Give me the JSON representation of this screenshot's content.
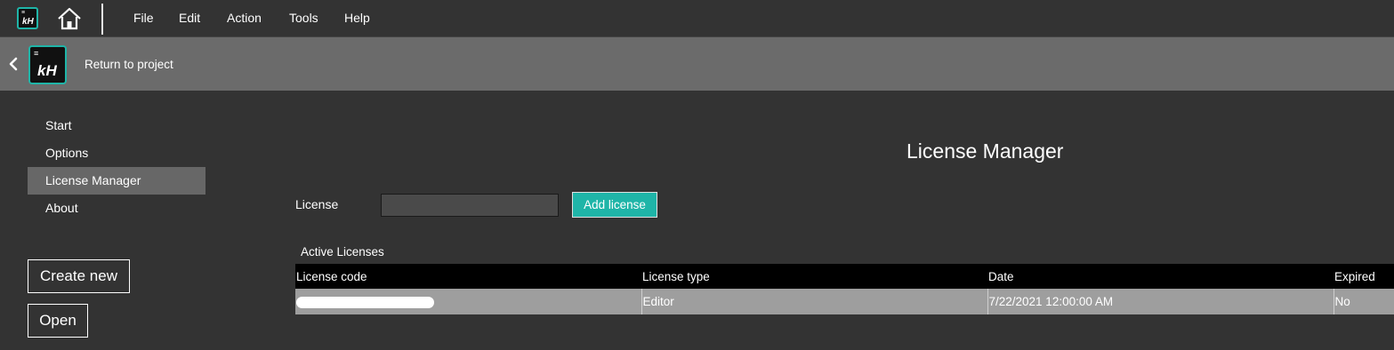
{
  "menubar": {
    "items": [
      "File",
      "Edit",
      "Action",
      "Tools",
      "Help"
    ],
    "logo_text": "kH"
  },
  "project_bar": {
    "return_label": "Return to project",
    "logo_text": "kH"
  },
  "sidebar": {
    "items": [
      {
        "label": "Start",
        "active": false
      },
      {
        "label": "Options",
        "active": false
      },
      {
        "label": "License Manager",
        "active": true
      },
      {
        "label": "About",
        "active": false
      }
    ],
    "create_new_label": "Create new",
    "open_label": "Open"
  },
  "main": {
    "title": "License Manager",
    "license_label": "License",
    "license_input_value": "",
    "add_license_label": "Add license",
    "active_licenses_label": "Active Licenses",
    "table": {
      "headers": [
        "License code",
        "License type",
        "Date",
        "Expired"
      ],
      "rows": [
        [
          "",
          "Editor",
          "7/22/2021 12:00:00 AM",
          "No"
        ]
      ]
    }
  },
  "colors": {
    "accent": "#1fb5a8",
    "background": "#333333",
    "project_bar": "#6b6b6b",
    "active_sidebar": "#676767",
    "table_header": "#000000",
    "table_row": "#9e9e9e"
  },
  "icons": [
    "app-logo-icon",
    "home-icon",
    "chevron-left-icon"
  ]
}
